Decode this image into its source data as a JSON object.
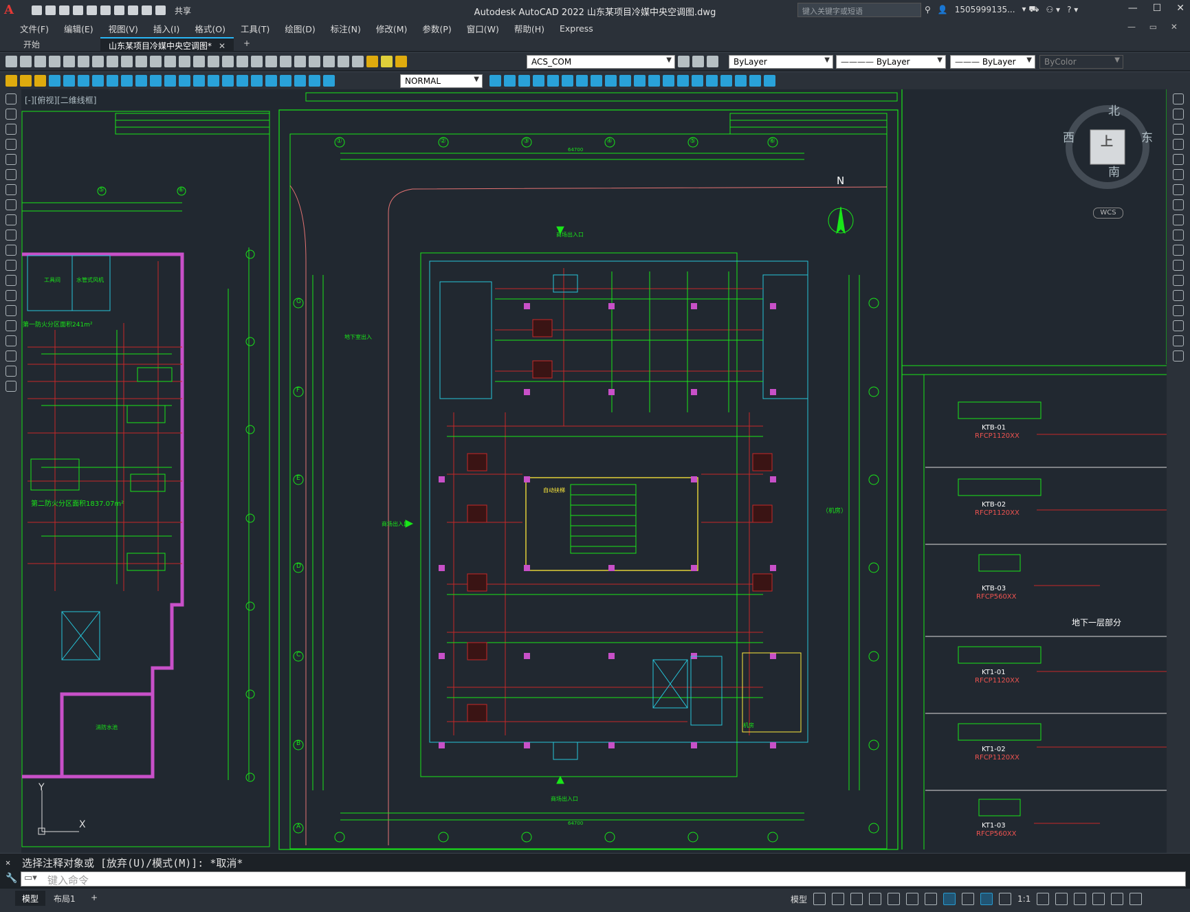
{
  "app": {
    "title": "Autodesk AutoCAD 2022    山东某项目冷媒中央空调图.dwg",
    "logo": "A",
    "share_label": "共享"
  },
  "search": {
    "placeholder": "键入关键字或短语"
  },
  "user": {
    "name": "1505999135..."
  },
  "window_controls": [
    "—",
    "☐",
    "✕"
  ],
  "menu": [
    "文件(F)",
    "编辑(E)",
    "视图(V)",
    "插入(I)",
    "格式(O)",
    "工具(T)",
    "绘图(D)",
    "标注(N)",
    "修改(M)",
    "参数(P)",
    "窗口(W)",
    "帮助(H)",
    "Express"
  ],
  "tabs": [
    {
      "label": "开始"
    },
    {
      "label": "山东某项目冷媒中央空调图*"
    }
  ],
  "toolbar": {
    "layer": "ACS_COM",
    "color": "ByLayer",
    "linetype": "ByLayer",
    "lineweight": "ByLayer",
    "plotstyle": "ByColor",
    "dimstyle": "NORMAL"
  },
  "viewport_label": "[-][俯视][二维线框]",
  "viewcube": {
    "north": "北",
    "south": "南",
    "east": "东",
    "west": "西",
    "face": "上",
    "wcs": "WCS"
  },
  "compass": "N",
  "drawing": {
    "grid_top": [
      "①",
      "②",
      "③",
      "④",
      "⑤",
      "⑥"
    ],
    "grid_side": [
      "G",
      "F",
      "E",
      "D",
      "C",
      "B",
      "A"
    ],
    "left_grid_top": [
      "⑤",
      "⑥"
    ],
    "total_dim": "64700",
    "labels": {
      "entrance_top": "商场出入口",
      "entrance_bottom": "商场出入口",
      "entrance_left": "商场出入口",
      "left_area1": "第一防火分区面积241m²",
      "left_area2": "第二防火分区面积1837.07m²",
      "left_room1": "工具间",
      "left_room2": "水管式风机",
      "left_room3": "消防水池",
      "mid_note": "地下室出入",
      "escalator": "自动扶梯",
      "machine": "机房",
      "right_note": "（机房）"
    }
  },
  "schedule": [
    {
      "id": "KTB-01",
      "model": "RFCP1120XX"
    },
    {
      "id": "KTB-02",
      "model": "RFCP1120XX"
    },
    {
      "id": "KTB-03",
      "model": "RFCP560XX"
    },
    {
      "id": "KT1-01",
      "model": "RFCP1120XX"
    },
    {
      "id": "KT1-02",
      "model": "RFCP1120XX"
    },
    {
      "id": "KT1-03",
      "model": "RFCP560XX"
    }
  ],
  "schedule_section": "地下一层部分",
  "ucs": {
    "y": "Y",
    "x": "X"
  },
  "command": {
    "history": "选择注释对象或 [放弃(U)/模式(M)]: *取消*",
    "placeholder": "键入命令"
  },
  "status": {
    "model_tab": "模型",
    "layout_tab": "布局1",
    "model_btn": "模型",
    "scale": "1:1"
  },
  "colors": {
    "bg": "#212830",
    "green": "#19e619",
    "red": "#c62828",
    "cyan": "#26c6da",
    "magenta": "#c850c8",
    "yellow": "#e6e619",
    "accent": "#29b6f6"
  }
}
